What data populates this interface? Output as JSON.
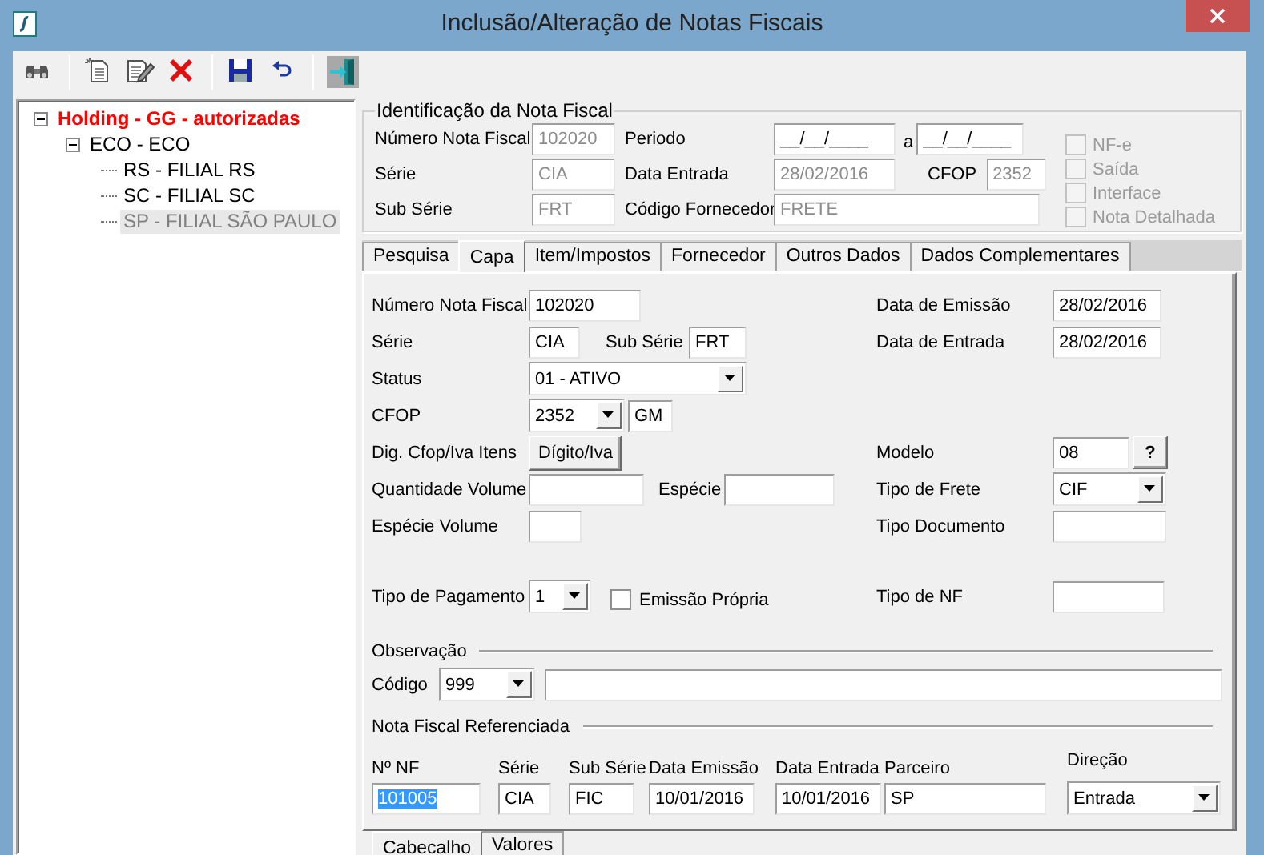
{
  "window": {
    "title": "Inclusão/Alteração de Notas Fiscais"
  },
  "tree": [
    {
      "label": "Holding -  GG -  autorizadas",
      "color": "#ff0000",
      "selected": false,
      "expanded": true,
      "children": [
        {
          "label": "ECO - ECO",
          "color": "#000000",
          "selected": false,
          "expanded": true,
          "children": [
            {
              "label": "RS - FILIAL RS",
              "color": "#000000",
              "selected": false
            },
            {
              "label": "SC - FILIAL SC",
              "color": "#000000",
              "selected": false
            },
            {
              "label": "SP - FILIAL SÃO PAULO",
              "color": "#808080",
              "selected": true
            }
          ]
        }
      ]
    }
  ],
  "identification": {
    "title": "Identificação da Nota Fiscal",
    "numero": {
      "label": "Número Nota Fiscal",
      "value": "102020",
      "disabled": true
    },
    "serie": {
      "label": "Série",
      "value": "CIA",
      "disabled": true
    },
    "sub_serie": {
      "label": "Sub Série",
      "value": "FRT",
      "disabled": true
    },
    "periodo": {
      "label": "Periodo",
      "from": "__/__/____",
      "separator": "a",
      "to": "__/__/____"
    },
    "data_entrada": {
      "label": "Data Entrada",
      "value": "28/02/2016",
      "disabled": true
    },
    "cfop": {
      "label": "CFOP",
      "value": "2352",
      "disabled": true
    },
    "codigo_fornecedor": {
      "label": "Código Fornecedor",
      "value": "FRETE",
      "disabled": true
    },
    "options": [
      {
        "label": "NF-e",
        "checked": false,
        "disabled": true
      },
      {
        "label": "Saída",
        "checked": false,
        "disabled": true
      },
      {
        "label": "Interface",
        "checked": false,
        "disabled": true
      },
      {
        "label": "Nota Detalhada",
        "checked": false,
        "disabled": true
      }
    ]
  },
  "tabs": [
    {
      "label": "Pesquisa",
      "selected": false
    },
    {
      "label": "Capa",
      "selected": true
    },
    {
      "label": "Item/Impostos",
      "selected": false
    },
    {
      "label": "Fornecedor",
      "selected": false
    },
    {
      "label": "Outros Dados",
      "selected": false
    },
    {
      "label": "Dados Complementares",
      "selected": false
    }
  ],
  "capa": {
    "numero_nota_fiscal": {
      "label": "Número Nota Fiscal",
      "value": "102020"
    },
    "data_emissao": {
      "label": "Data de Emissão",
      "value": "28/02/2016"
    },
    "serie": {
      "label": "Série",
      "value": "CIA"
    },
    "sub_serie": {
      "label": "Sub Série",
      "value": "FRT"
    },
    "data_entrada": {
      "label": "Data de Entrada",
      "value": "28/02/2016"
    },
    "status": {
      "label": "Status",
      "value": "01 - ATIVO"
    },
    "cfop": {
      "label": "CFOP",
      "value": "2352",
      "description": "GM"
    },
    "dig_cfop_iva": {
      "label": "Dig. Cfop/Iva Itens",
      "button": "Dígito/Iva"
    },
    "modelo": {
      "label": "Modelo",
      "value": "08",
      "help_button": "?"
    },
    "quantidade_volume": {
      "label": "Quantidade Volume"
    },
    "especie": {
      "label": "Espécie"
    },
    "tipo_frete": {
      "label": "Tipo de Frete",
      "value": "CIF"
    },
    "especie_volume": {
      "label": "Espécie Volume"
    },
    "tipo_documento": {
      "label": "Tipo Documento"
    },
    "tipo_pagamento": {
      "label": "Tipo de Pagamento",
      "value": "1"
    },
    "emissao_propria": {
      "label": "Emissão Própria",
      "checked": false
    },
    "tipo_nf": {
      "label": "Tipo de NF"
    },
    "observacao": {
      "title": "Observação",
      "codigo_label": "Código",
      "codigo": "999"
    },
    "referenciada": {
      "title": "Nota Fiscal Referenciada",
      "columns": [
        {
          "label": "Nº NF",
          "value": "101005",
          "kind": "text",
          "highlighted": true
        },
        {
          "label": "Série",
          "value": "CIA",
          "kind": "text",
          "highlighted": false
        },
        {
          "label": "Sub Série",
          "value": "FIC",
          "kind": "text",
          "highlighted": false
        },
        {
          "label": "Data Emissão",
          "value": "10/01/2016",
          "kind": "text",
          "highlighted": false
        },
        {
          "label": "Data Entrada",
          "value": "10/01/2016",
          "kind": "text",
          "highlighted": false
        },
        {
          "label": "Parceiro",
          "value": "SP",
          "kind": "text",
          "highlighted": false
        },
        {
          "label": "Direção",
          "value": "Entrada",
          "kind": "dropdown",
          "highlighted": false
        }
      ]
    }
  },
  "subtabs": [
    {
      "label": "Cabecalho",
      "selected": true
    },
    {
      "label": "Valores",
      "selected": false
    }
  ]
}
